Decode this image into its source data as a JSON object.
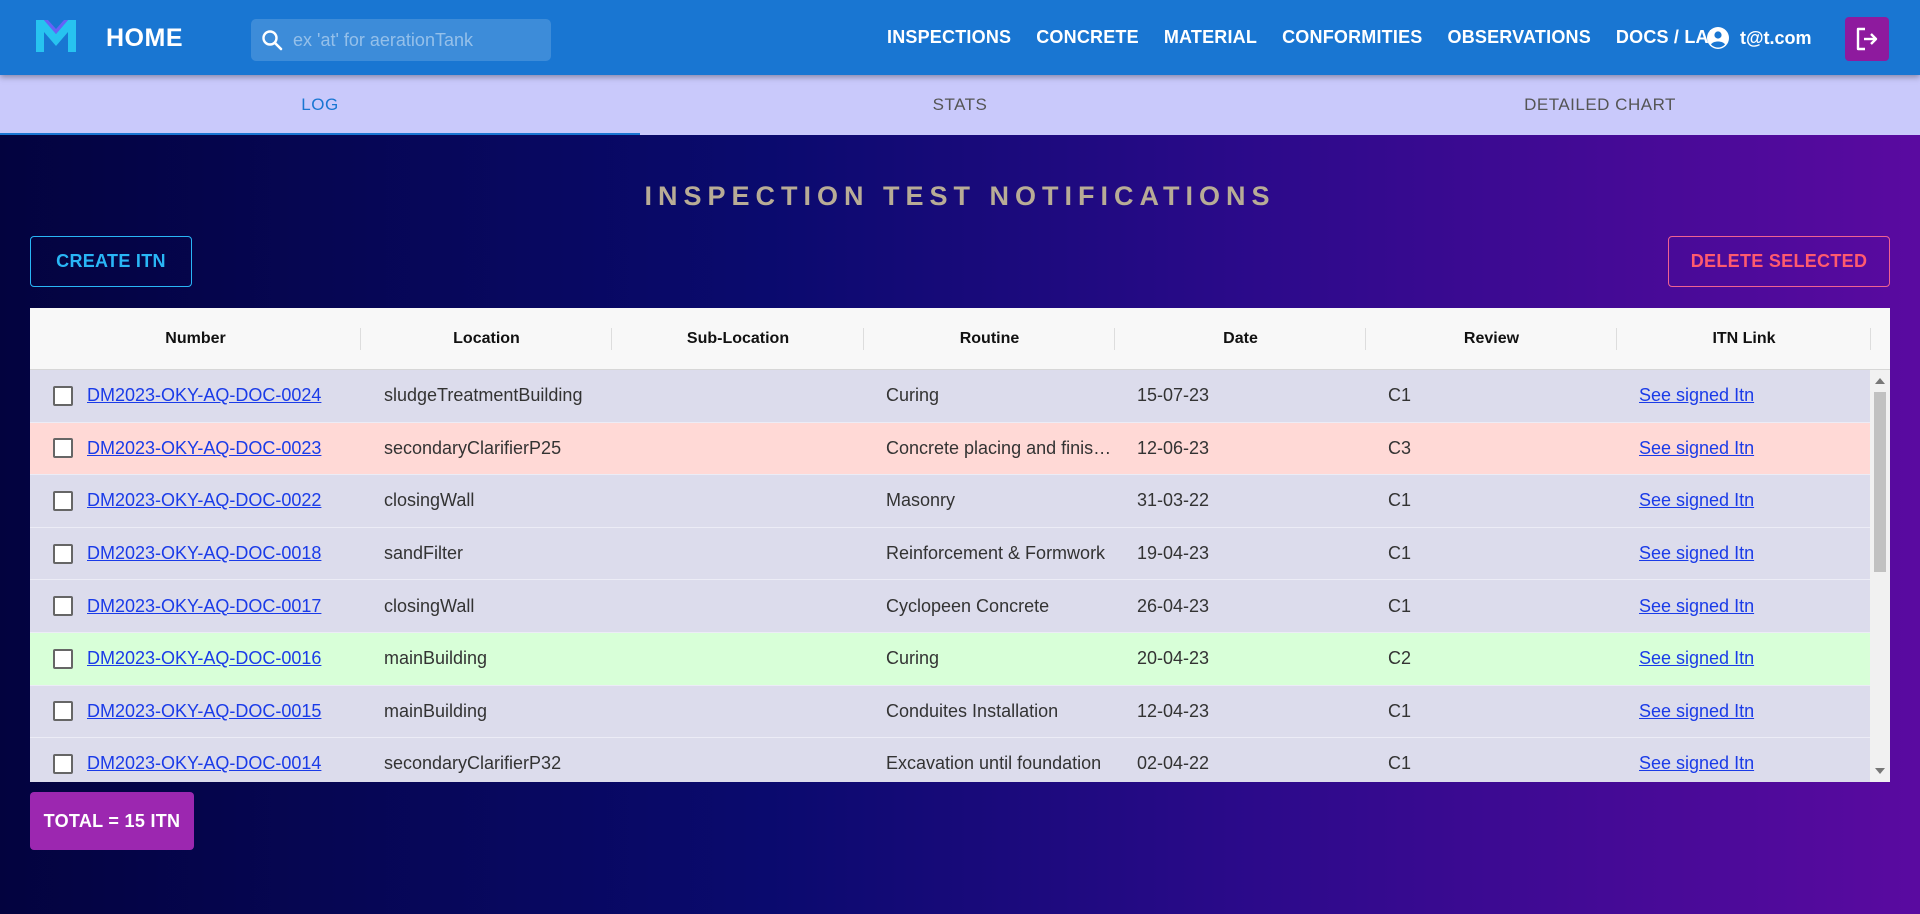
{
  "header": {
    "home_label": "HOME",
    "search_placeholder": "ex 'at' for aerationTank",
    "nav": [
      "INSPECTIONS",
      "CONCRETE",
      "MATERIAL",
      "CONFORMITIES",
      "OBSERVATIONS",
      "DOCS / LAB"
    ],
    "user_email": "t@t.com",
    "icons": {
      "logo": "m-logo-icon",
      "search": "search-icon",
      "user": "account-circle-icon",
      "logout": "logout-icon"
    }
  },
  "tabs": [
    {
      "label": "LOG",
      "active": true
    },
    {
      "label": "STATS",
      "active": false
    },
    {
      "label": "DETAILED CHART",
      "active": false
    }
  ],
  "page": {
    "title": "INSPECTION TEST NOTIFICATIONS",
    "create_label": "CREATE ITN",
    "delete_label": "DELETE SELECTED",
    "total_label": "TOTAL = 15 ITN"
  },
  "table": {
    "columns": [
      "Number",
      "Location",
      "Sub-Location",
      "Routine",
      "Date",
      "Review",
      "ITN Link"
    ],
    "rows": [
      {
        "number": "DM2023-OKY-AQ-DOC-0024",
        "location": "sludgeTreatmentBuilding",
        "sublocation": "",
        "routine": "Curing",
        "date": "15-07-23",
        "review": "C1",
        "link": "See signed Itn"
      },
      {
        "number": "DM2023-OKY-AQ-DOC-0023",
        "location": "secondaryClarifierP25",
        "sublocation": "",
        "routine": "Concrete placing and finishing",
        "date": "12-06-23",
        "review": "C3",
        "link": "See signed Itn"
      },
      {
        "number": "DM2023-OKY-AQ-DOC-0022",
        "location": "closingWall",
        "sublocation": "",
        "routine": "Masonry",
        "date": "31-03-22",
        "review": "C1",
        "link": "See signed Itn"
      },
      {
        "number": "DM2023-OKY-AQ-DOC-0018",
        "location": "sandFilter",
        "sublocation": "",
        "routine": "Reinforcement & Formwork",
        "date": "19-04-23",
        "review": "C1",
        "link": "See signed Itn"
      },
      {
        "number": "DM2023-OKY-AQ-DOC-0017",
        "location": "closingWall",
        "sublocation": "",
        "routine": "Cyclopeen Concrete",
        "date": "26-04-23",
        "review": "C1",
        "link": "See signed Itn"
      },
      {
        "number": "DM2023-OKY-AQ-DOC-0016",
        "location": "mainBuilding",
        "sublocation": "",
        "routine": "Curing",
        "date": "20-04-23",
        "review": "C2",
        "link": "See signed Itn"
      },
      {
        "number": "DM2023-OKY-AQ-DOC-0015",
        "location": "mainBuilding",
        "sublocation": "",
        "routine": "Conduites Installation",
        "date": "12-04-23",
        "review": "C1",
        "link": "See signed Itn"
      },
      {
        "number": "DM2023-OKY-AQ-DOC-0014",
        "location": "secondaryClarifierP32",
        "sublocation": "",
        "routine": "Excavation until foundation",
        "date": "02-04-22",
        "review": "C1",
        "link": "See signed Itn"
      }
    ]
  },
  "colors": {
    "appbar": "#1976d2",
    "tabs_bg": "#c9c9fb",
    "title": "#b8ac96",
    "create": "#29b6f6",
    "delete": "#ff5a6e",
    "row_c3": "#ffd9d6",
    "row_c2": "#d8ffd8",
    "total_badge": "#9c27b0"
  }
}
